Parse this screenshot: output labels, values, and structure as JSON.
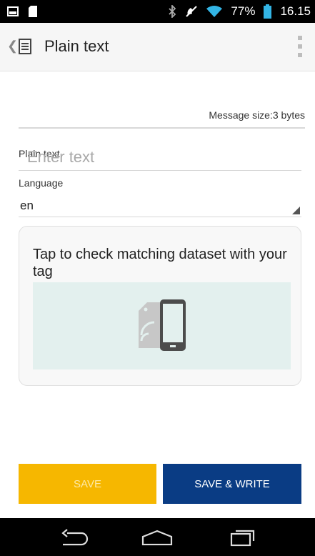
{
  "status_bar": {
    "battery_percent": "77%",
    "time": "16.15"
  },
  "action_bar": {
    "title": "Plain text"
  },
  "message_size": "Message size:3 bytes",
  "form": {
    "plain_text_label": "Plain text",
    "plain_text_placeholder": "Enter text",
    "plain_text_value": "",
    "language_label": "Language",
    "language_value": "en"
  },
  "card": {
    "text": "Tap to check matching dataset with your tag",
    "illustration_icon": "nfc-phone-tag-icon",
    "illustration_bg": "#e3f0ee"
  },
  "buttons": {
    "save_label": "SAVE",
    "save_write_label": "SAVE & WRITE",
    "save_color": "#f6b700",
    "save_write_color": "#0a3c84"
  },
  "nav_bar": {
    "icons": [
      "back-icon",
      "home-icon",
      "recents-icon"
    ]
  }
}
